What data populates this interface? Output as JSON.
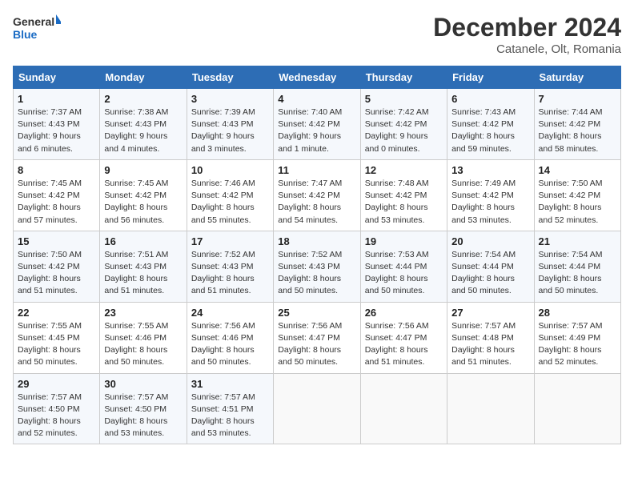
{
  "header": {
    "logo_general": "General",
    "logo_blue": "Blue",
    "title": "December 2024",
    "subtitle": "Catanele, Olt, Romania"
  },
  "weekdays": [
    "Sunday",
    "Monday",
    "Tuesday",
    "Wednesday",
    "Thursday",
    "Friday",
    "Saturday"
  ],
  "weeks": [
    [
      {
        "day": "1",
        "sunrise": "Sunrise: 7:37 AM",
        "sunset": "Sunset: 4:43 PM",
        "daylight": "Daylight: 9 hours and 6 minutes."
      },
      {
        "day": "2",
        "sunrise": "Sunrise: 7:38 AM",
        "sunset": "Sunset: 4:43 PM",
        "daylight": "Daylight: 9 hours and 4 minutes."
      },
      {
        "day": "3",
        "sunrise": "Sunrise: 7:39 AM",
        "sunset": "Sunset: 4:43 PM",
        "daylight": "Daylight: 9 hours and 3 minutes."
      },
      {
        "day": "4",
        "sunrise": "Sunrise: 7:40 AM",
        "sunset": "Sunset: 4:42 PM",
        "daylight": "Daylight: 9 hours and 1 minute."
      },
      {
        "day": "5",
        "sunrise": "Sunrise: 7:42 AM",
        "sunset": "Sunset: 4:42 PM",
        "daylight": "Daylight: 9 hours and 0 minutes."
      },
      {
        "day": "6",
        "sunrise": "Sunrise: 7:43 AM",
        "sunset": "Sunset: 4:42 PM",
        "daylight": "Daylight: 8 hours and 59 minutes."
      },
      {
        "day": "7",
        "sunrise": "Sunrise: 7:44 AM",
        "sunset": "Sunset: 4:42 PM",
        "daylight": "Daylight: 8 hours and 58 minutes."
      }
    ],
    [
      {
        "day": "8",
        "sunrise": "Sunrise: 7:45 AM",
        "sunset": "Sunset: 4:42 PM",
        "daylight": "Daylight: 8 hours and 57 minutes."
      },
      {
        "day": "9",
        "sunrise": "Sunrise: 7:45 AM",
        "sunset": "Sunset: 4:42 PM",
        "daylight": "Daylight: 8 hours and 56 minutes."
      },
      {
        "day": "10",
        "sunrise": "Sunrise: 7:46 AM",
        "sunset": "Sunset: 4:42 PM",
        "daylight": "Daylight: 8 hours and 55 minutes."
      },
      {
        "day": "11",
        "sunrise": "Sunrise: 7:47 AM",
        "sunset": "Sunset: 4:42 PM",
        "daylight": "Daylight: 8 hours and 54 minutes."
      },
      {
        "day": "12",
        "sunrise": "Sunrise: 7:48 AM",
        "sunset": "Sunset: 4:42 PM",
        "daylight": "Daylight: 8 hours and 53 minutes."
      },
      {
        "day": "13",
        "sunrise": "Sunrise: 7:49 AM",
        "sunset": "Sunset: 4:42 PM",
        "daylight": "Daylight: 8 hours and 53 minutes."
      },
      {
        "day": "14",
        "sunrise": "Sunrise: 7:50 AM",
        "sunset": "Sunset: 4:42 PM",
        "daylight": "Daylight: 8 hours and 52 minutes."
      }
    ],
    [
      {
        "day": "15",
        "sunrise": "Sunrise: 7:50 AM",
        "sunset": "Sunset: 4:42 PM",
        "daylight": "Daylight: 8 hours and 51 minutes."
      },
      {
        "day": "16",
        "sunrise": "Sunrise: 7:51 AM",
        "sunset": "Sunset: 4:43 PM",
        "daylight": "Daylight: 8 hours and 51 minutes."
      },
      {
        "day": "17",
        "sunrise": "Sunrise: 7:52 AM",
        "sunset": "Sunset: 4:43 PM",
        "daylight": "Daylight: 8 hours and 51 minutes."
      },
      {
        "day": "18",
        "sunrise": "Sunrise: 7:52 AM",
        "sunset": "Sunset: 4:43 PM",
        "daylight": "Daylight: 8 hours and 50 minutes."
      },
      {
        "day": "19",
        "sunrise": "Sunrise: 7:53 AM",
        "sunset": "Sunset: 4:44 PM",
        "daylight": "Daylight: 8 hours and 50 minutes."
      },
      {
        "day": "20",
        "sunrise": "Sunrise: 7:54 AM",
        "sunset": "Sunset: 4:44 PM",
        "daylight": "Daylight: 8 hours and 50 minutes."
      },
      {
        "day": "21",
        "sunrise": "Sunrise: 7:54 AM",
        "sunset": "Sunset: 4:44 PM",
        "daylight": "Daylight: 8 hours and 50 minutes."
      }
    ],
    [
      {
        "day": "22",
        "sunrise": "Sunrise: 7:55 AM",
        "sunset": "Sunset: 4:45 PM",
        "daylight": "Daylight: 8 hours and 50 minutes."
      },
      {
        "day": "23",
        "sunrise": "Sunrise: 7:55 AM",
        "sunset": "Sunset: 4:46 PM",
        "daylight": "Daylight: 8 hours and 50 minutes."
      },
      {
        "day": "24",
        "sunrise": "Sunrise: 7:56 AM",
        "sunset": "Sunset: 4:46 PM",
        "daylight": "Daylight: 8 hours and 50 minutes."
      },
      {
        "day": "25",
        "sunrise": "Sunrise: 7:56 AM",
        "sunset": "Sunset: 4:47 PM",
        "daylight": "Daylight: 8 hours and 50 minutes."
      },
      {
        "day": "26",
        "sunrise": "Sunrise: 7:56 AM",
        "sunset": "Sunset: 4:47 PM",
        "daylight": "Daylight: 8 hours and 51 minutes."
      },
      {
        "day": "27",
        "sunrise": "Sunrise: 7:57 AM",
        "sunset": "Sunset: 4:48 PM",
        "daylight": "Daylight: 8 hours and 51 minutes."
      },
      {
        "day": "28",
        "sunrise": "Sunrise: 7:57 AM",
        "sunset": "Sunset: 4:49 PM",
        "daylight": "Daylight: 8 hours and 52 minutes."
      }
    ],
    [
      {
        "day": "29",
        "sunrise": "Sunrise: 7:57 AM",
        "sunset": "Sunset: 4:50 PM",
        "daylight": "Daylight: 8 hours and 52 minutes."
      },
      {
        "day": "30",
        "sunrise": "Sunrise: 7:57 AM",
        "sunset": "Sunset: 4:50 PM",
        "daylight": "Daylight: 8 hours and 53 minutes."
      },
      {
        "day": "31",
        "sunrise": "Sunrise: 7:57 AM",
        "sunset": "Sunset: 4:51 PM",
        "daylight": "Daylight: 8 hours and 53 minutes."
      },
      null,
      null,
      null,
      null
    ]
  ]
}
